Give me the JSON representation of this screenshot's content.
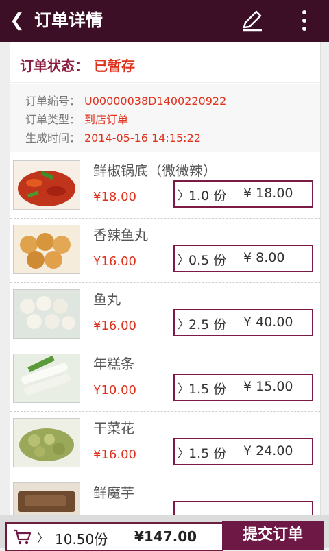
{
  "header": {
    "title": "订单详情"
  },
  "order": {
    "status_label": "订单状态：",
    "status_value": "已暂存",
    "fields": [
      {
        "label": "订单编号：",
        "value": "U00000038D1400220922"
      },
      {
        "label": "订单类型：",
        "value": "到店订单"
      },
      {
        "label": "生成时间：",
        "value": "2014-05-16 14:15:22"
      }
    ]
  },
  "items": [
    {
      "name": "鲜椒锅底（微微辣）",
      "price": "¥18.00",
      "qty": "1.0 份",
      "subtotal": "¥ 18.00",
      "image": "spicy-pepper-hotpot-base"
    },
    {
      "name": "香辣鱼丸",
      "price": "¥16.00",
      "qty": "0.5 份",
      "subtotal": "¥ 8.00",
      "image": "fried-fish-balls"
    },
    {
      "name": "鱼丸",
      "price": "¥16.00",
      "qty": "2.5 份",
      "subtotal": "¥ 40.00",
      "image": "fish-balls"
    },
    {
      "name": "年糕条",
      "price": "¥10.00",
      "qty": "1.5 份",
      "subtotal": "¥ 15.00",
      "image": "rice-cake-strips"
    },
    {
      "name": "干菜花",
      "price": "¥16.00",
      "qty": "1.5 份",
      "subtotal": "¥ 24.00",
      "image": "dried-cauliflower"
    },
    {
      "name": "鲜魔芋",
      "price": "",
      "qty": "",
      "subtotal": "",
      "image": "konjac"
    }
  ],
  "footer": {
    "arrow": "〉",
    "count": "10.50份",
    "total": "¥147.00",
    "submit_label": "提交订单"
  },
  "colors": {
    "header_bg": "#3d0f27",
    "accent": "#6e1845",
    "price": "#e0311c"
  }
}
